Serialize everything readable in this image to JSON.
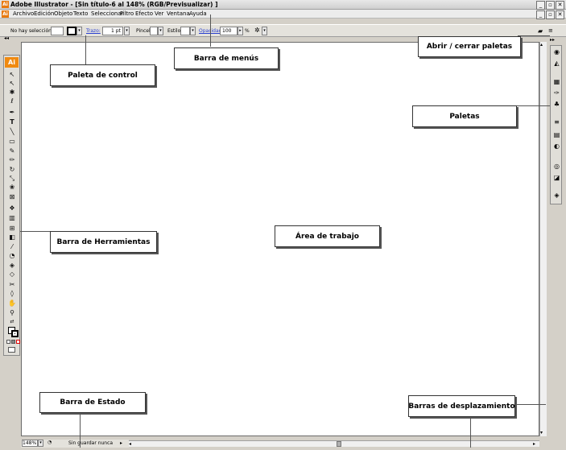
{
  "window": {
    "title": "Adobe Illustrator - [Sin título-6 al 148% (RGB/Previsualizar) ]",
    "app_icon": "Ai"
  },
  "menu": [
    "Archivo",
    "Edición",
    "Objeto",
    "Texto",
    "Seleccionar",
    "Filtro",
    "Efecto",
    "Ver",
    "Ventana",
    "Ayuda"
  ],
  "control_palette": {
    "selection": "No hay selección",
    "stroke_label": "Trazo:",
    "stroke_value": "1 pt",
    "brush_label": "Pincel:",
    "style_label": "Estilo:",
    "opacity_label": "Opacidad:",
    "opacity_value": "100",
    "percent": "%"
  },
  "toolbox": {
    "logo": "Ai",
    "tools": [
      "selection-arrow",
      "direct-selection",
      "magic-wand",
      "lasso",
      "pen",
      "type",
      "line",
      "rectangle",
      "paintbrush",
      "pencil",
      "rotate",
      "scale",
      "warp",
      "free-transform",
      "symbol-sprayer",
      "column-graph",
      "mesh",
      "gradient",
      "eyedropper",
      "blend",
      "live-paint",
      "live-paint-selection",
      "slice",
      "eraser",
      "scissors",
      "hand",
      "zoom"
    ]
  },
  "status_bar": {
    "zoom": "148%",
    "status": "Sin guardar nunca"
  },
  "callouts": {
    "control_palette": "Paleta de control",
    "menu_bar": "Barra de menús",
    "toggle_palettes": "Abrir / cerrar paletas",
    "palettes": "Paletas",
    "toolbar": "Barra de Herramientas",
    "workspace": "Área de trabajo",
    "status_bar": "Barra de Estado",
    "scrollbars": "Barras de desplazamiento"
  },
  "colors": {
    "accent": "#f08a10",
    "link": "#2a3fd0"
  }
}
